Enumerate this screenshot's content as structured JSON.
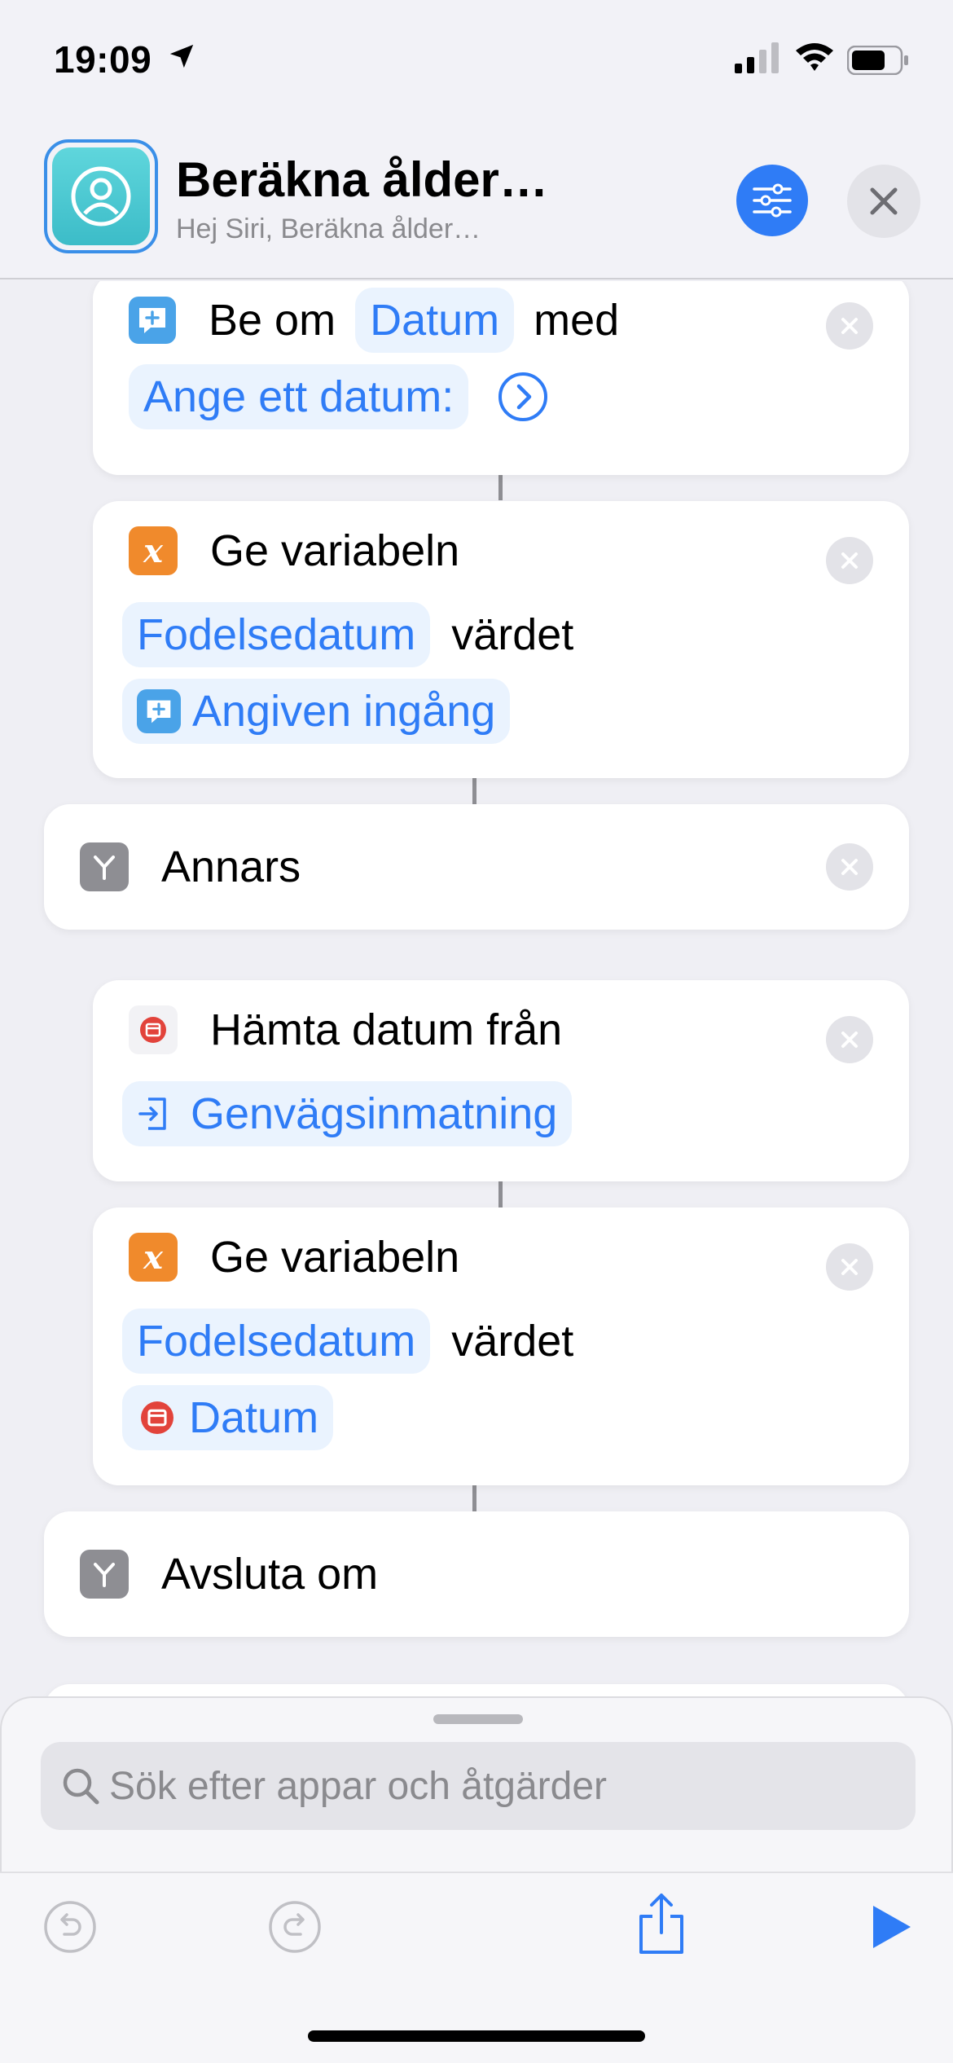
{
  "status": {
    "time": "19:09"
  },
  "header": {
    "title": "Beräkna ålder…",
    "subtitle": "Hej Siri, Beräkna ålder…"
  },
  "actions": [
    {
      "id": "ask",
      "words": [
        "Be om",
        "med"
      ],
      "tokens": [
        "Datum",
        "Ange ett datum:"
      ]
    },
    {
      "id": "setvar1",
      "word1": "Ge variabeln",
      "token1": "Fodelsedatum",
      "word2": "värdet",
      "token2": "Angiven ingång"
    },
    {
      "id": "otherwise",
      "label": "Annars"
    },
    {
      "id": "getdate",
      "word": "Hämta datum från",
      "token": "Genvägsinmatning"
    },
    {
      "id": "setvar2",
      "word1": "Ge variabeln",
      "token1": "Fodelsedatum",
      "word2": "värdet",
      "token2": "Datum"
    },
    {
      "id": "endif",
      "label": "Avsluta om"
    }
  ],
  "search": {
    "placeholder": "Sök efter appar och åtgärder"
  },
  "icons": {
    "ask": "ask-input-icon",
    "variable": "variable-x-icon",
    "if": "branch-icon",
    "date": "calendar-icon",
    "shortcut_input": "shortcut-input-icon"
  },
  "colors": {
    "accent": "#2f7cf6",
    "variable": "#f08a2c",
    "date": "#e2433b",
    "if": "#8e8e93",
    "ask": "#4aa3e8"
  }
}
